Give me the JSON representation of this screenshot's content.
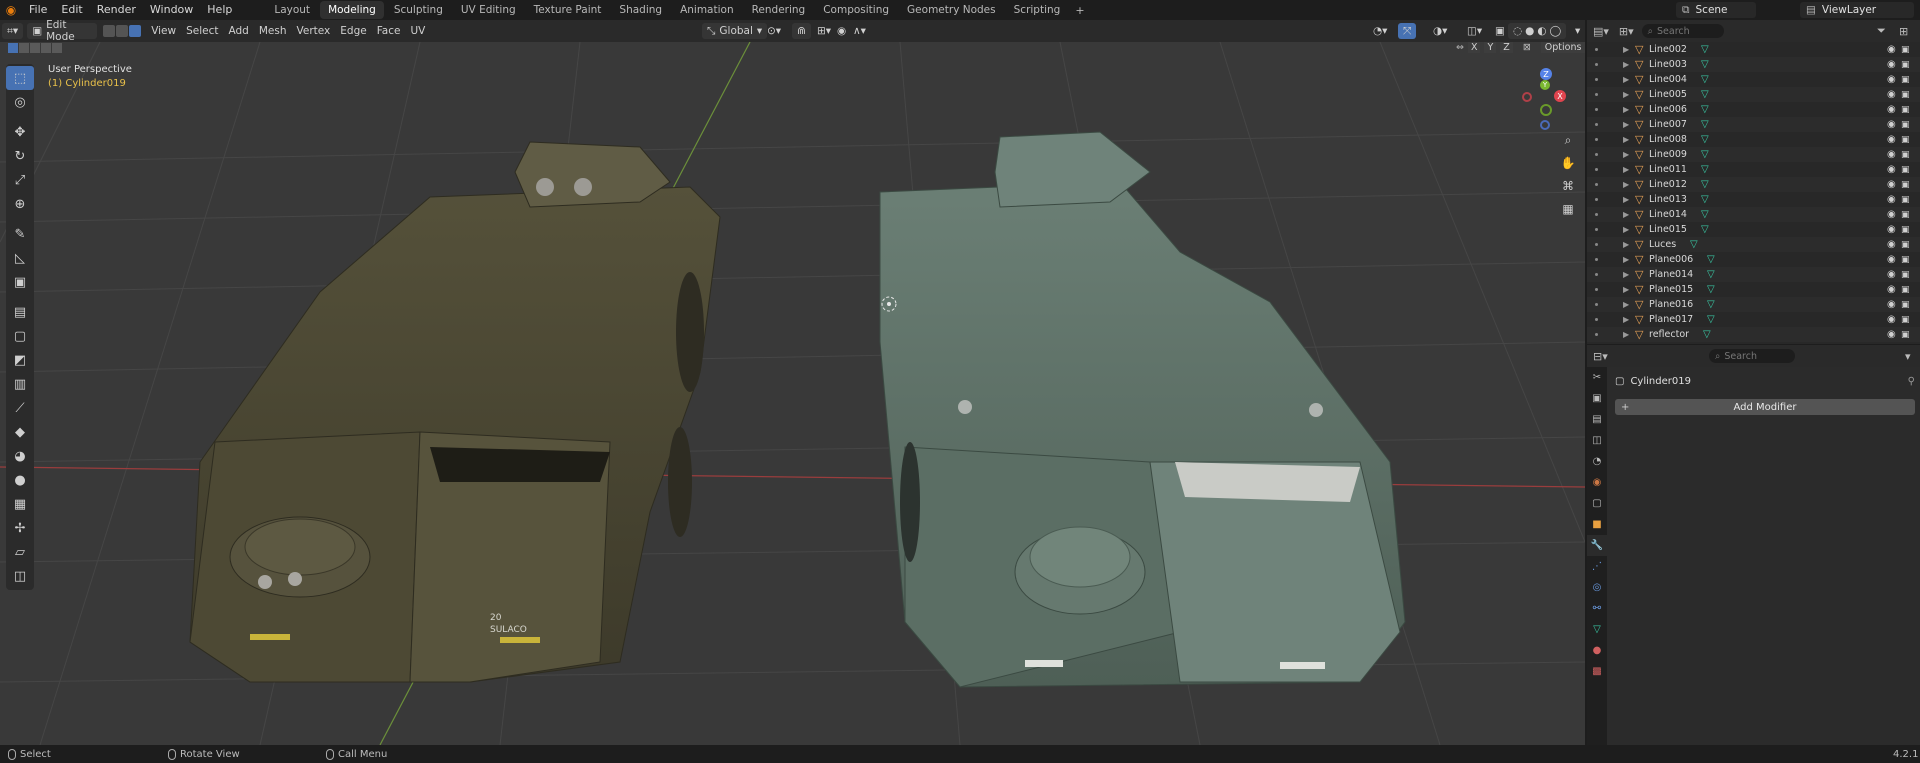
{
  "topbar": {
    "menus": [
      "File",
      "Edit",
      "Render",
      "Window",
      "Help"
    ],
    "workspaces": [
      "Layout",
      "Modeling",
      "Sculpting",
      "UV Editing",
      "Texture Paint",
      "Shading",
      "Animation",
      "Rendering",
      "Compositing",
      "Geometry Nodes",
      "Scripting"
    ],
    "active_workspace": "Modeling",
    "add_workspace": "+",
    "scene": "Scene",
    "view_layer": "ViewLayer"
  },
  "viewport_header": {
    "mode": "Edit Mode",
    "menus": [
      "View",
      "Select",
      "Add",
      "Mesh",
      "Vertex",
      "Edge",
      "Face",
      "UV"
    ],
    "transform_orientation": "Global",
    "axes": [
      "X",
      "Y",
      "Z"
    ],
    "options": "Options"
  },
  "viewport": {
    "view_name": "User Perspective",
    "object_info": "(1) Cylinder019",
    "gizmo_labels": {
      "x": "X",
      "y": "Y",
      "z": "Z"
    },
    "decals": {
      "brand": "SULACO",
      "number": "20"
    }
  },
  "outliner": {
    "search_placeholder": "Search",
    "rows": [
      {
        "name": "Line002"
      },
      {
        "name": "Line003"
      },
      {
        "name": "Line004"
      },
      {
        "name": "Line005"
      },
      {
        "name": "Line006"
      },
      {
        "name": "Line007"
      },
      {
        "name": "Line008"
      },
      {
        "name": "Line009"
      },
      {
        "name": "Line011"
      },
      {
        "name": "Line012"
      },
      {
        "name": "Line013"
      },
      {
        "name": "Line014"
      },
      {
        "name": "Line015"
      },
      {
        "name": "Luces"
      },
      {
        "name": "Plane006"
      },
      {
        "name": "Plane014"
      },
      {
        "name": "Plane015"
      },
      {
        "name": "Plane016"
      },
      {
        "name": "Plane017"
      },
      {
        "name": "reflector"
      }
    ]
  },
  "properties": {
    "search_placeholder": "Search",
    "object_name": "Cylinder019",
    "add_modifier": "Add Modifier"
  },
  "statusbar": {
    "select": "Select",
    "rotate": "Rotate View",
    "call_menu": "Call Menu",
    "version": "4.2.1"
  },
  "colors": {
    "accent": "#4772b3",
    "viewport_bg": "#393939",
    "tank_textured": "#4a4632",
    "tank_plain": "#55685e"
  }
}
